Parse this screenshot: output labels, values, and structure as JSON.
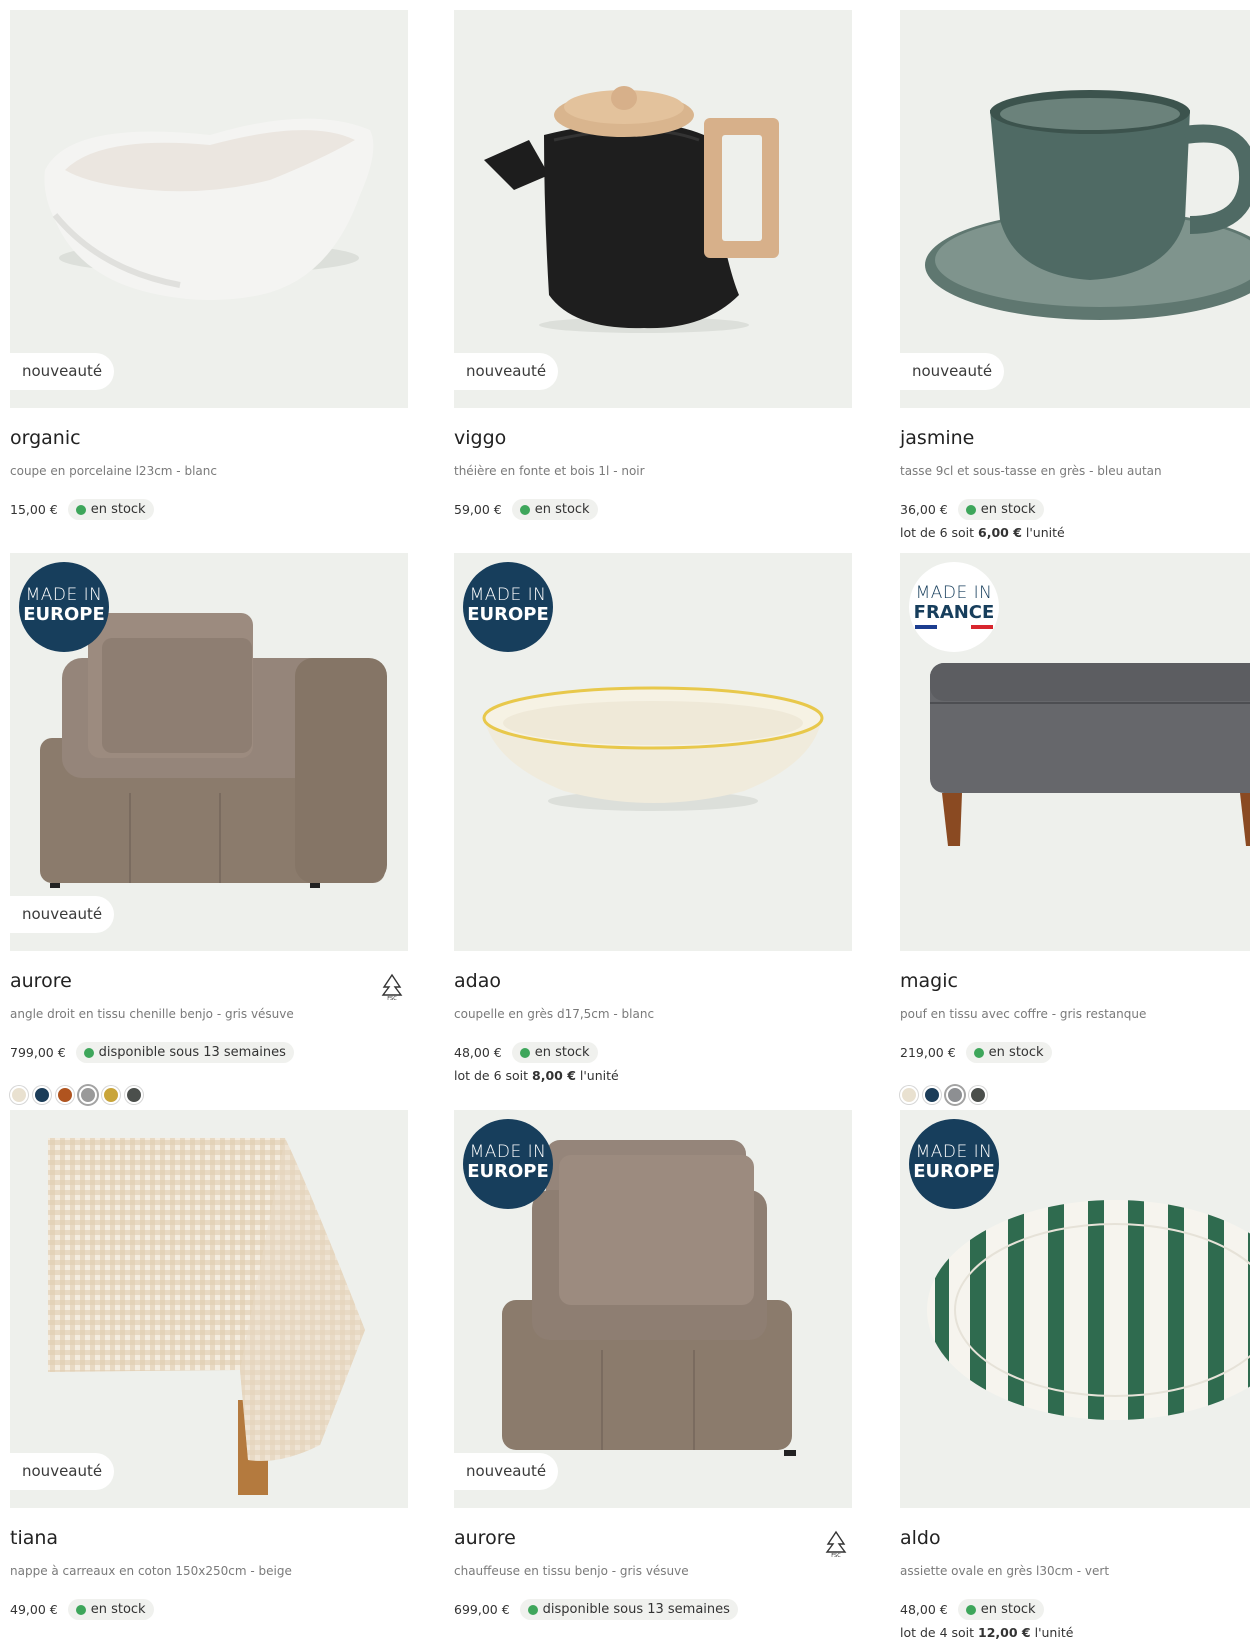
{
  "products": [
    {
      "name": "organic",
      "description": "coupe en porcelaine l23cm - blanc",
      "price": "15,00 €",
      "stock": "en stock",
      "badge": "nouveauté"
    },
    {
      "name": "viggo",
      "description": "théière en fonte et bois 1l - noir",
      "price": "59,00 €",
      "stock": "en stock",
      "badge": "nouveauté"
    },
    {
      "name": "jasmine",
      "description": "tasse 9cl et sous-tasse en grès - bleu autan",
      "price": "36,00 €",
      "stock": "en stock",
      "badge": "nouveauté",
      "lot_prefix": "lot de 6 soit ",
      "lot_unit_price": "6,00 €",
      "lot_suffix": " l'unité"
    },
    {
      "name": "aurore",
      "description": "angle droit en tissu chenille benjo - gris vésuve",
      "price": "799,00 €",
      "stock": "disponible sous 13 semaines",
      "badge": "nouveauté",
      "made_in_l1": "MADE IN",
      "made_in_l2": "EUROPE",
      "swatches": [
        "#e9e1d0",
        "#1c3d59",
        "#b0541f",
        "#9a9a9a",
        "#c9a53a",
        "#4b4f4c"
      ],
      "selected_swatch": 3
    },
    {
      "name": "adao",
      "description": "coupelle en grès d17,5cm - blanc",
      "price": "48,00 €",
      "stock": "en stock",
      "made_in_l1": "MADE IN",
      "made_in_l2": "EUROPE",
      "lot_prefix": "lot de 6 soit ",
      "lot_unit_price": "8,00 €",
      "lot_suffix": " l'unité"
    },
    {
      "name": "magic",
      "description": "pouf en tissu avec coffre - gris restanque",
      "price": "219,00 €",
      "stock": "en stock",
      "made_in_l1": "MADE IN",
      "made_in_l2": "FRANCE",
      "swatches": [
        "#e9e1d0",
        "#1c3d59",
        "#8d8f92",
        "#4b4f4c"
      ],
      "selected_swatch": 2
    },
    {
      "name": "tiana",
      "description": "nappe à carreaux en coton 150x250cm - beige",
      "price": "49,00 €",
      "stock": "en stock",
      "badge": "nouveauté",
      "swatches": [
        "#e9e1d0",
        "#3f5a52"
      ],
      "selected_swatch": 0
    },
    {
      "name": "aurore",
      "description": "chauffeuse en tissu benjo - gris vésuve",
      "price": "699,00 €",
      "stock": "disponible sous 13 semaines",
      "badge": "nouveauté",
      "made_in_l1": "MADE IN",
      "made_in_l2": "EUROPE",
      "swatches": [
        "#e9e1d0",
        "#1c3d59",
        "#b0541f",
        "#9a9a9a",
        "#c9a53a",
        "#4b4f4c"
      ],
      "selected_swatch": 3
    },
    {
      "name": "aldo",
      "description": "assiette ovale en grès l30cm - vert",
      "price": "48,00 €",
      "stock": "en stock",
      "made_in_l1": "MADE IN",
      "made_in_l2": "EUROPE",
      "lot_prefix": "lot de 4 soit ",
      "lot_unit_price": "12,00 €",
      "lot_suffix": " l'unité"
    }
  ],
  "colors": {
    "image_bg": "#eef0ec",
    "badge_blue": "#173e5c",
    "stock_green": "#3ea65b",
    "flag_blue": "#1c3d8f",
    "flag_red": "#d8262e"
  },
  "icons": {
    "fsc": "fsc-tree-icon",
    "stock": "stock-dot-icon"
  }
}
